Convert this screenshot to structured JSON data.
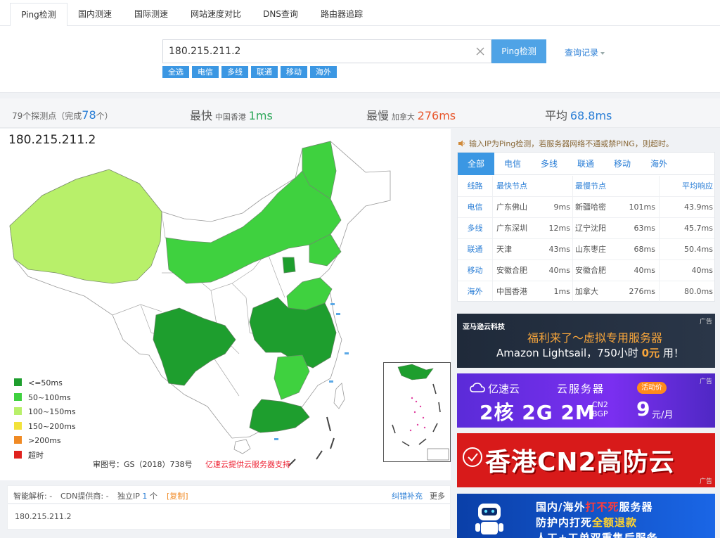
{
  "tabs": [
    {
      "label": "Ping检测",
      "active": true
    },
    {
      "label": "国内测速"
    },
    {
      "label": "国际测速"
    },
    {
      "label": "网站速度对比"
    },
    {
      "label": "DNS查询"
    },
    {
      "label": "路由器追踪"
    }
  ],
  "search": {
    "value": "180.215.211.2",
    "button": "Ping检测",
    "history": "查询记录",
    "filters": [
      "全选",
      "电信",
      "多线",
      "联通",
      "移动",
      "海外"
    ]
  },
  "summary": {
    "nodes_prefix": "79个探测点（完成",
    "nodes_done": "78",
    "nodes_suffix": "个）",
    "fastest_label": "最快",
    "fastest_loc": "中国香港",
    "fastest_val": "1ms",
    "slowest_label": "最慢",
    "slowest_loc": "加拿大",
    "slowest_val": "276ms",
    "avg_label": "平均",
    "avg_val": "68.8ms"
  },
  "map": {
    "title": "180.215.211.2",
    "legend": [
      {
        "label": "<=50ms",
        "color": "#1e9e2e"
      },
      {
        "label": "50~100ms",
        "color": "#3fd13f"
      },
      {
        "label": "100~150ms",
        "color": "#b8f06a"
      },
      {
        "label": "150~200ms",
        "color": "#f2e23a"
      },
      {
        "label": ">200ms",
        "color": "#f08a24"
      },
      {
        "label": "超时",
        "color": "#e0221e"
      }
    ],
    "approval": "审图号：GS（2018）738号",
    "provider": "亿速云提供云服务器支持"
  },
  "info": {
    "smart": "智能解析: -",
    "cdn": "CDN提供商: -",
    "ip_label": "独立IP",
    "ip_count": "1",
    "ip_unit": "个",
    "copy": "[复制]",
    "report": "纠错补充",
    "more": "更多",
    "result_ip": "180.215.211.2"
  },
  "notice": "输入IP为Ping检测，若服务器网络不通或禁PING，则超时。",
  "results": {
    "tabs": [
      "全部",
      "电信",
      "多线",
      "联通",
      "移动",
      "海外"
    ],
    "headers": {
      "line": "线路",
      "fast": "最快节点",
      "slow": "最慢节点",
      "avg": "平均响应"
    },
    "rows": [
      {
        "line": "电信",
        "fast": "广东佛山",
        "fastv": "9ms",
        "slow": "新疆哈密",
        "slowv": "101ms",
        "avg": "43.9ms"
      },
      {
        "line": "多线",
        "fast": "广东深圳",
        "fastv": "12ms",
        "slow": "辽宁沈阳",
        "slowv": "63ms",
        "avg": "45.7ms"
      },
      {
        "line": "联通",
        "fast": "天津",
        "fastv": "43ms",
        "slow": "山东枣庄",
        "slowv": "68ms",
        "avg": "50.4ms"
      },
      {
        "line": "移动",
        "fast": "安徽合肥",
        "fastv": "40ms",
        "slow": "安徽合肥",
        "slowv": "40ms",
        "avg": "40ms"
      },
      {
        "line": "海外",
        "fast": "中国香港",
        "fastv": "1ms",
        "slow": "加拿大",
        "slowv": "276ms",
        "avg": "80.0ms"
      }
    ]
  },
  "ads": {
    "tag": "广告",
    "ad1": {
      "brand": "亚马逊云科技",
      "line1": "福利来了～虚拟专用服务器",
      "line2a": "Amazon Lightsail，750小时",
      "line2b": "0元",
      "line2c": "用！"
    },
    "ad2": {
      "brand": "亿速云",
      "title": "云服务器",
      "badge": "活动价",
      "spec": "2核 2G 2M",
      "cn2a": "CN2",
      "cn2b": "BGP",
      "price": "9",
      "unit": "元/月"
    },
    "ad3": {
      "text": "香港CN2高防云"
    },
    "ad4": {
      "line1a": "国内/海外",
      "line1b": "打不死",
      "line1c": "服务器",
      "line2a": "防护内打死",
      "line2b": "全额退款",
      "line3a": "",
      "line3b": "人工+工单双重售后服务"
    }
  }
}
